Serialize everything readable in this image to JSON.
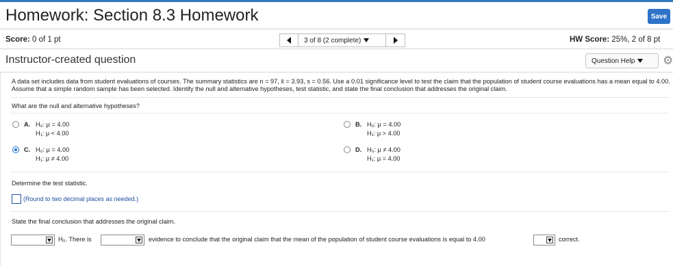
{
  "header": {
    "title": "Homework: Section 8.3 Homework",
    "save_label": "Save",
    "score_label": "Score:",
    "score_value": "0 of 1 pt",
    "question_nav": "3 of 8 (2 complete)",
    "hw_score_label": "HW Score:",
    "hw_score_value": "25%, 2 of 8 pt",
    "subtitle": "Instructor-created question",
    "help_label": "Question Help"
  },
  "problem": {
    "text": "A data set includes data from student evaluations of courses. The summary statistics are n = 97, x̄ = 3.93, s = 0.56. Use a 0.01 significance level to test the claim that the population of student course evaluations has a mean equal to 4.00. Assume that a simple random sample has been selected. Identify the null and alternative hypotheses, test statistic, and state the final conclusion that addresses the original claim.",
    "question1": "What are the null and alternative hypotheses?",
    "options": [
      {
        "letter": "A.",
        "h0": "H₀: μ = 4.00",
        "h1": "H₁: μ < 4.00",
        "selected": false
      },
      {
        "letter": "B.",
        "h0": "H₀: μ = 4.00",
        "h1": "H₁: μ > 4.00",
        "selected": false
      },
      {
        "letter": "C.",
        "h0": "H₀: μ = 4.00",
        "h1": "H₁: μ ≠ 4.00",
        "selected": true
      },
      {
        "letter": "D.",
        "h0": "H₀: μ ≠ 4.00",
        "h1": "H₁: μ = 4.00",
        "selected": false
      }
    ],
    "question2": "Determine the test statistic.",
    "round_note": "(Round to two decimal places as needed.)",
    "question3": "State the final conclusion that addresses the original claim.",
    "final_h0": "H₀. There is",
    "final_mid": "evidence to conclude that the original claim that the mean of the population of student course evaluations is equal to 4.00",
    "final_end": "correct."
  },
  "colors": {
    "accent": "#2e73c9",
    "link": "#1f4fa0",
    "selected_radio": "#1a6ccc"
  },
  "icons": {
    "prev": "triangle-left-icon",
    "next": "triangle-right-icon",
    "dropdown": "chevron-down-icon",
    "settings": "gear-icon"
  }
}
